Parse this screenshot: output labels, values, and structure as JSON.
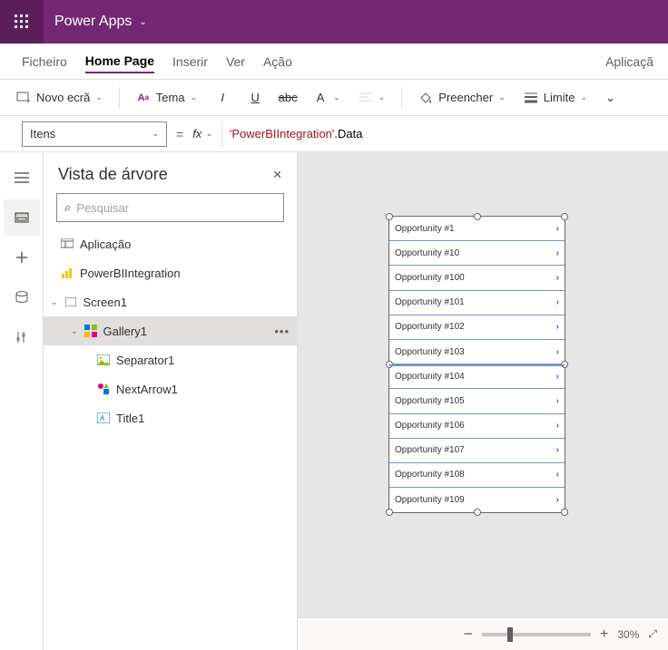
{
  "titlebar": {
    "app": "Power Apps"
  },
  "menubar": {
    "items": [
      "Ficheiro",
      "Home Page",
      "Inserir",
      "Ver",
      "Ação"
    ],
    "active": 1,
    "right": "Aplicaçã"
  },
  "toolbar": {
    "newscreen": "Novo ecrã",
    "theme": "Tema",
    "fill": "Preencher",
    "border": "Limite"
  },
  "formula": {
    "property": "Itens",
    "fx": "fx",
    "string": "'PowerBIIntegration'",
    "suffix": ".Data"
  },
  "tree": {
    "title": "Vista de árvore",
    "searchPlaceholder": "Pesquisar",
    "app": "Aplicação",
    "pbi": "PowerBIIntegration",
    "screen": "Screen1",
    "gallery": "Gallery1",
    "sep": "Separator1",
    "arrow": "NextArrow1",
    "title1": "Title1"
  },
  "gallery": {
    "items": [
      "Opportunity #1",
      "Opportunity #10",
      "Opportunity #100",
      "Opportunity #101",
      "Opportunity #102",
      "Opportunity #103",
      "Opportunity #104",
      "Opportunity #105",
      "Opportunity #106",
      "Opportunity #107",
      "Opportunity #108",
      "Opportunity #109"
    ]
  },
  "status": {
    "zoom": "30%"
  }
}
